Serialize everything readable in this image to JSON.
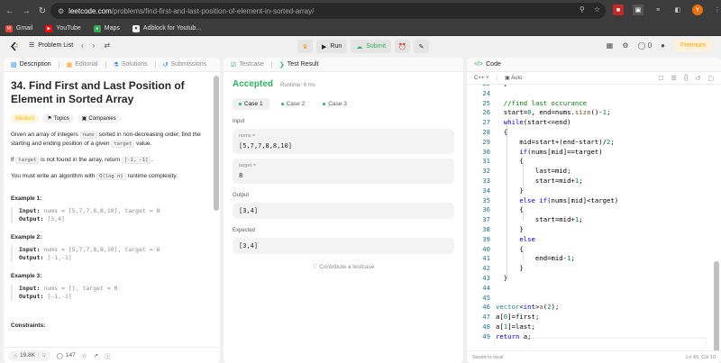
{
  "browser": {
    "url_host": "leetcode.com",
    "url_path": "/problems/find-first-and-last-position-of-element-in-sorted-array/",
    "profile_initial": "Y",
    "bookmarks": [
      {
        "label": "Gmail",
        "color": "#ea4335"
      },
      {
        "label": "YouTube",
        "color": "#ff0000"
      },
      {
        "label": "Maps",
        "color": "#34a853"
      },
      {
        "label": "Adblock for Youtub...",
        "color": "#555555"
      }
    ]
  },
  "topbar": {
    "problem_list": "Problem List",
    "run": "Run",
    "submit": "Submit",
    "streak_count": "0",
    "premium": "Premium"
  },
  "description": {
    "tabs": [
      "Description",
      "Editorial",
      "Solutions",
      "Submissions"
    ],
    "title": "34. Find First and Last Position of Element in Sorted Array",
    "difficulty": "Medium",
    "topics": "Topics",
    "companies": "Companies",
    "para1_a": "Given an array of integers ",
    "para1_code1": "nums",
    "para1_b": " sorted in non-decreasing order, find the starting and ending position of a given ",
    "para1_code2": "target",
    "para1_c": " value.",
    "para2_a": "If ",
    "para2_code1": "target",
    "para2_b": " is not found in the array, return ",
    "para2_code2": "[-1, -1]",
    "para2_c": ".",
    "para3_a": "You must write an algorithm with ",
    "para3_code": "O(log n)",
    "para3_b": " runtime complexity.",
    "input_label": "Input:",
    "output_label": "Output:",
    "examples": [
      {
        "title": "Example 1:",
        "input": "nums = [5,7,7,8,8,10], target = 8",
        "output": "[3,4]"
      },
      {
        "title": "Example 2:",
        "input": "nums = [5,7,7,8,8,10], target = 6",
        "output": "[-1,-1]"
      },
      {
        "title": "Example 3:",
        "input": "nums = [], target = 0",
        "output": "[-1,-1]"
      }
    ],
    "constraints": "Constraints:",
    "likes": "19.8K",
    "comments": "147"
  },
  "result": {
    "tabs": [
      "Testcase",
      "Test Result"
    ],
    "status": "Accepted",
    "runtime": "Runtime: 6 ms",
    "cases": [
      "Case 1",
      "Case 2",
      "Case 3"
    ],
    "input_label": "Input",
    "nums_label": "nums =",
    "nums_value": "[5,7,7,8,8,10]",
    "target_label": "target =",
    "target_value": "8",
    "output_label": "Output",
    "output_value": "[3,4]",
    "expected_label": "Expected",
    "expected_value": "[3,4]",
    "contribute": "Contribute a testcase"
  },
  "code": {
    "tab": "Code",
    "language": "C++",
    "auto": "Auto",
    "status_left": "Saved to local",
    "status_right": "Ln 49, Col 10",
    "lines": [
      {
        "n": "23",
        "html": "  <span>}</span>"
      },
      {
        "n": "24",
        "html": ""
      },
      {
        "n": "25",
        "html": "  <span class='cm'>//find last occurance</span>"
      },
      {
        "n": "26",
        "html": "  start=<span class='num'>0</span>, end=nums.<span class='fn'>size</span>()-<span class='num'>1</span>;"
      },
      {
        "n": "27",
        "html": "  <span class='kw'>while</span>(start&lt;=end)"
      },
      {
        "n": "28",
        "html": "  {"
      },
      {
        "n": "29",
        "html": "      mid=start+(end-start)/<span class='num'>2</span>;"
      },
      {
        "n": "30",
        "html": "      <span class='kw'>if</span>(nums[mid]==target)"
      },
      {
        "n": "31",
        "html": "      {"
      },
      {
        "n": "32",
        "html": "          last=mid;"
      },
      {
        "n": "33",
        "html": "          start=mid+<span class='num'>1</span>;"
      },
      {
        "n": "34",
        "html": "      }"
      },
      {
        "n": "35",
        "html": "      <span class='kw'>else if</span>(nums[mid]&lt;target)"
      },
      {
        "n": "36",
        "html": "      {"
      },
      {
        "n": "37",
        "html": "          start=mid+<span class='num'>1</span>;"
      },
      {
        "n": "38",
        "html": "      }"
      },
      {
        "n": "39",
        "html": "      <span class='kw'>else</span>"
      },
      {
        "n": "40",
        "html": "      {"
      },
      {
        "n": "41",
        "html": "          end=mid-<span class='num'>1</span>;"
      },
      {
        "n": "42",
        "html": "      }"
      },
      {
        "n": "43",
        "html": "  }"
      },
      {
        "n": "44",
        "html": ""
      },
      {
        "n": "45",
        "html": ""
      },
      {
        "n": "46",
        "html": "<span class='typ'>vector</span>&lt;<span class='kw'>int</span>&gt;<span class='fn'>a</span>(<span class='num'>2</span>);"
      },
      {
        "n": "47",
        "html": "a[<span class='num'>0</span>]=first;"
      },
      {
        "n": "48",
        "html": "a[<span class='num'>1</span>]=last;"
      },
      {
        "n": "49",
        "html": "<span class='kw'>return</span> a;"
      }
    ]
  }
}
